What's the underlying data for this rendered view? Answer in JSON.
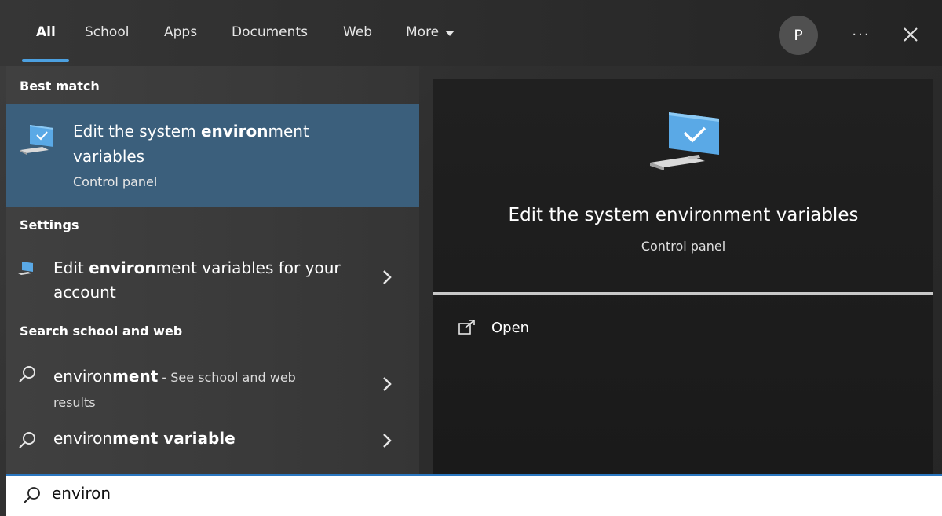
{
  "tabs": {
    "all": "All",
    "school": "School",
    "apps": "Apps",
    "documents": "Documents",
    "web": "Web",
    "more": "More"
  },
  "header": {
    "avatar_initial": "P",
    "more_options": "···",
    "close_icon": "close-icon"
  },
  "best_match": {
    "section_title": "Best match",
    "title_pre": "Edit the system ",
    "title_bold": "environ",
    "title_post": "ment variables",
    "subtitle": "Control panel",
    "icon": "monitor-checkmark-icon"
  },
  "settings": {
    "section_title": "Settings",
    "item": {
      "pre": "Edit ",
      "bold": "environ",
      "post": "ment variables for your account",
      "icon": "settings-monitor-icon"
    }
  },
  "search_web": {
    "section_title": "Search school and web",
    "items": [
      {
        "pre": "environ",
        "bold": "ment",
        "post": " - See school and web",
        "post2": "results",
        "icon": "search-icon"
      },
      {
        "pre": "environ",
        "bold": "ment variable",
        "post": "",
        "icon": "search-icon"
      }
    ]
  },
  "preview": {
    "title": "Edit the system environment variables",
    "subtitle": "Control panel",
    "open_label": "Open",
    "icon": "monitor-checkmark-icon"
  },
  "search": {
    "value": "environ",
    "icon": "search-icon"
  },
  "colors": {
    "accent": "#4ca0e0",
    "selected_bg": "#3b5f7c",
    "search_border": "#2b77c0"
  }
}
